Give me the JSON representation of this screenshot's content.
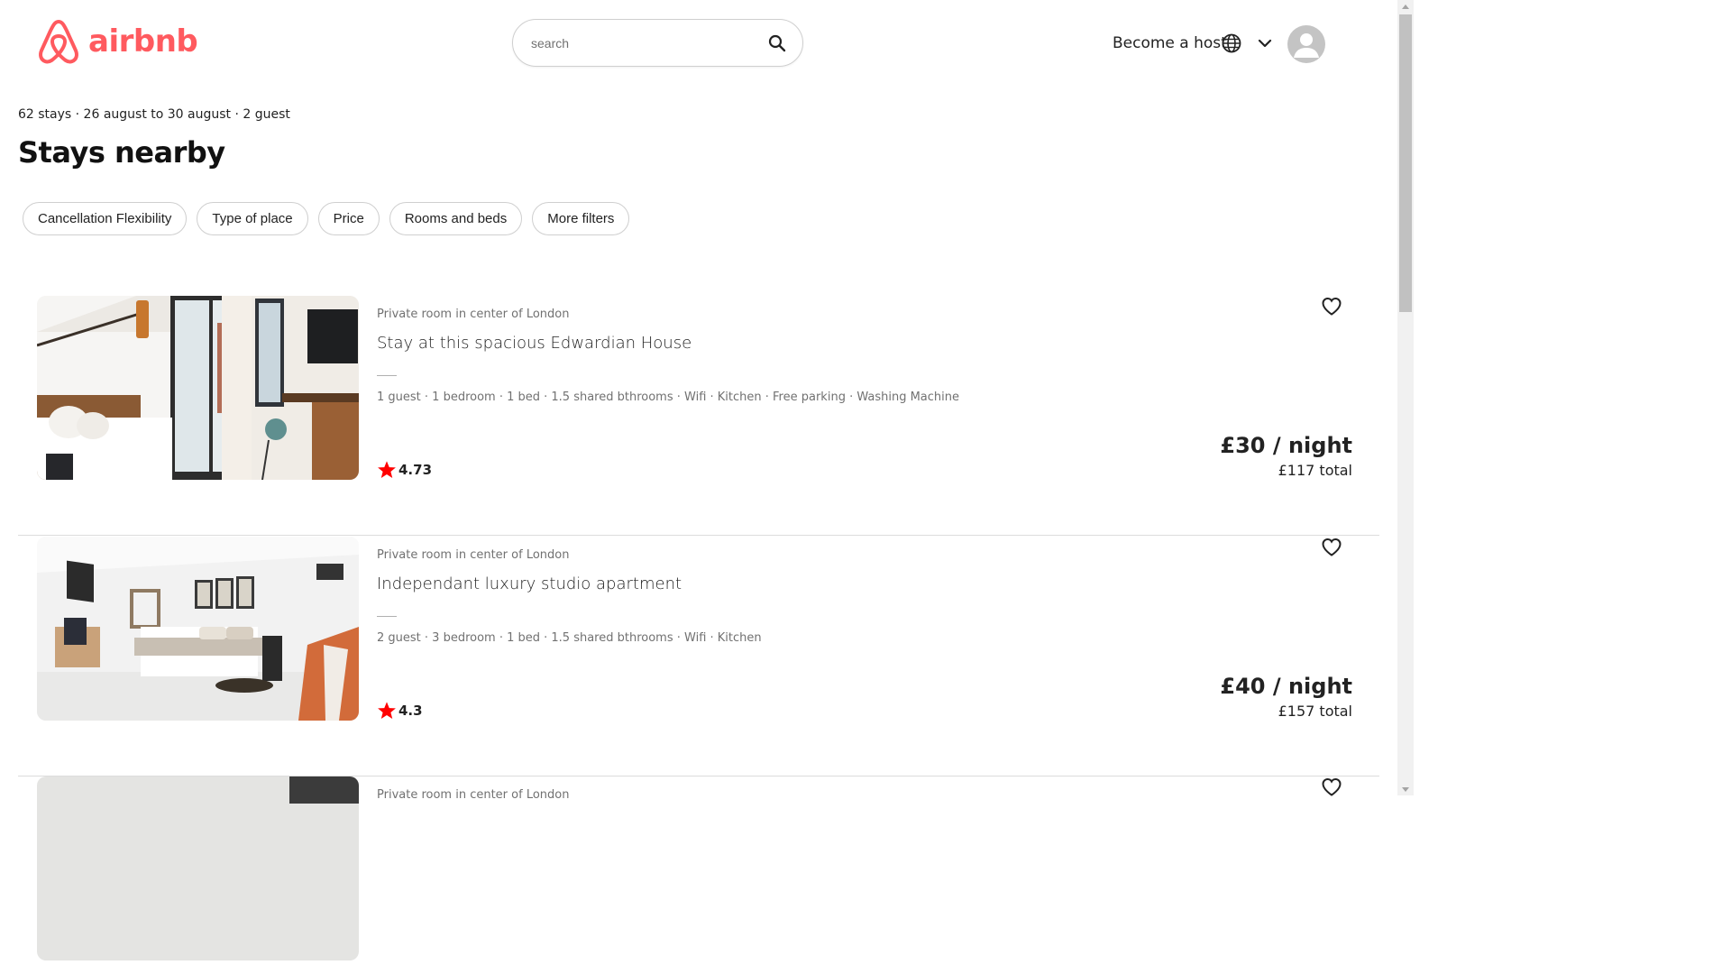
{
  "brand": {
    "name": "airbnb",
    "color": "#FF5A5F"
  },
  "search": {
    "placeholder": "search",
    "value": ""
  },
  "nav": {
    "become_host": "Become a host",
    "icons": [
      "globe-icon",
      "chevron-down-icon",
      "avatar-icon"
    ]
  },
  "summary": "62 stays · 26 august to 30 august · 2 guest",
  "page_title": "Stays nearby",
  "filters": [
    "Cancellation Flexibility",
    "Type of place",
    "Price",
    "Rooms and beds",
    "More filters"
  ],
  "listings": [
    {
      "type": "Private room in center of London",
      "name": "Stay at this spacious Edwardian House",
      "amenities": "1 guest · 1 bedroom · 1 bed · 1.5 shared bthrooms · Wifi · Kitchen · Free parking · Washing Machine",
      "rating": "4.73",
      "price": "£30 / night",
      "total": "£117 total"
    },
    {
      "type": "Private room in center of London",
      "name": "Independant luxury studio apartment",
      "amenities": "2 guest · 3 bedroom · 1 bed · 1.5 shared bthrooms · Wifi · Kitchen",
      "rating": "4.3",
      "price": "£40 / night",
      "total": "£157 total"
    },
    {
      "type": "Private room in center of London"
    }
  ],
  "colors": {
    "star": "#FF0000",
    "text": "#222222",
    "muted": "#717171",
    "border": "#DCDCDC"
  }
}
